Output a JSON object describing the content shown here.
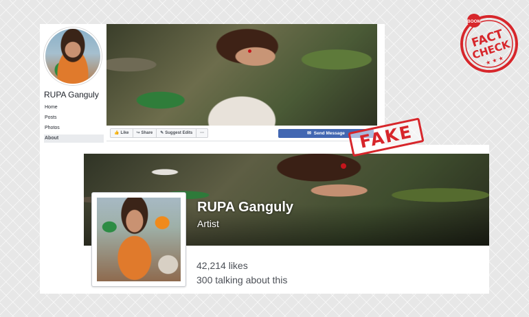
{
  "top_page": {
    "name": "RUPA Ganguly",
    "nav": [
      "Home",
      "Posts",
      "Photos",
      "About"
    ],
    "active_nav": "About",
    "actions": {
      "like": "Like",
      "share": "Share",
      "suggest_edits": "Suggest Edits",
      "more": "···"
    },
    "send_message": "Send Message"
  },
  "bottom_page": {
    "name": "RUPA Ganguly",
    "category": "Artist",
    "likes": "42,214 likes",
    "talking": "300 talking about this"
  },
  "stamps": {
    "fake": "FAKE",
    "badge_top": "BOOM",
    "badge_line1": "FACT",
    "badge_line2": "CHECK"
  },
  "colors": {
    "facebook_blue": "#4267b2",
    "stamp_red": "#d7262b"
  },
  "icons": [
    "thumbs-up-icon",
    "share-icon",
    "pencil-icon",
    "messenger-icon"
  ]
}
